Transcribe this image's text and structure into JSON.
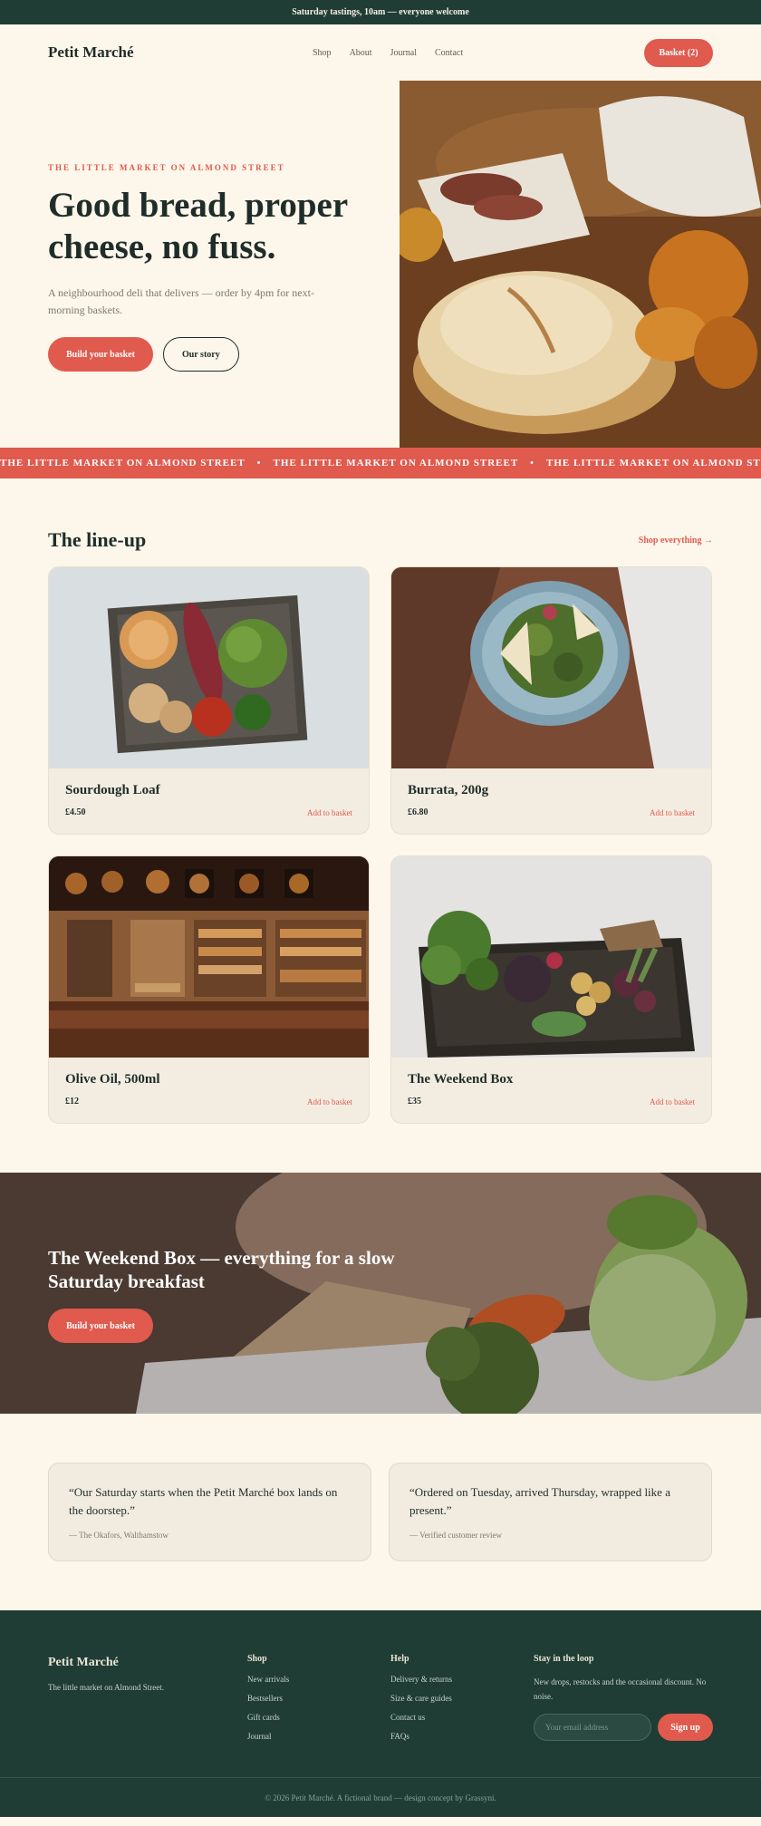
{
  "topbar": {
    "text": "Saturday tastings, 10am — everyone welcome"
  },
  "nav": {
    "logo": "Petit Marché",
    "links": [
      "Shop",
      "About",
      "Journal",
      "Contact"
    ],
    "basket": "Basket (2)"
  },
  "hero": {
    "eyebrow": "THE LITTLE MARKET ON ALMOND STREET",
    "title": "Good bread, proper cheese, no fuss.",
    "subtitle": "A neighbourhood deli that delivers — order by 4pm for next-morning baskets.",
    "primary_cta": "Build your basket",
    "secondary_cta": "Our story"
  },
  "marquee": {
    "items": [
      "THE LITTLE MARKET ON ALMOND STREET",
      "•",
      "THE LITTLE MARKET ON ALMOND STREET",
      "•",
      "THE LITTLE MARKET ON ALMOND STREET"
    ]
  },
  "lineup": {
    "title": "The line-up",
    "shop_link": "Shop everything →",
    "products": [
      {
        "name": "Sourdough Loaf",
        "price": "£4.50",
        "action": "Add to basket"
      },
      {
        "name": "Burrata, 200g",
        "price": "£6.80",
        "action": "Add to basket"
      },
      {
        "name": "Olive Oil, 500ml",
        "price": "£12",
        "action": "Add to basket"
      },
      {
        "name": "The Weekend Box",
        "price": "£35",
        "action": "Add to basket"
      }
    ]
  },
  "promo": {
    "title": "The Weekend Box — everything for a slow Saturday breakfast",
    "cta": "Build your basket"
  },
  "reviews": [
    {
      "quote": "“Our Saturday starts when the Petit Marché box lands on the doorstep.”",
      "cite": "— The Okafors, Walthamstow"
    },
    {
      "quote": "“Ordered on Tuesday, arrived Thursday, wrapped like a present.”",
      "cite": "— Verified customer review"
    }
  ],
  "footer": {
    "logo": "Petit Marché",
    "tagline": "The little market on Almond Street.",
    "shop": {
      "heading": "Shop",
      "links": [
        "New arrivals",
        "Bestsellers",
        "Gift cards",
        "Journal"
      ]
    },
    "help": {
      "heading": "Help",
      "links": [
        "Delivery & returns",
        "Size & care guides",
        "Contact us",
        "FAQs"
      ]
    },
    "newsletter": {
      "heading": "Stay in the loop",
      "description": "New drops, restocks and the occasional discount. No noise.",
      "placeholder": "Your email address",
      "button": "Sign up"
    },
    "copyright": "© 2026 Petit Marché. A fictional brand — design concept by Grassyni."
  },
  "colors": {
    "accent": "#e05a4e",
    "dark": "#1f3d35",
    "cream": "#fdf6ea"
  }
}
